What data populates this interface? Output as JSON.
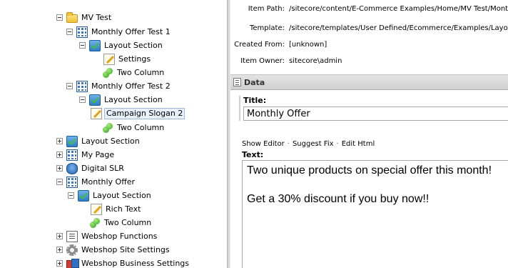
{
  "tree": [
    {
      "label": "MV Test",
      "icon": "folder-icon",
      "expanded": true
    },
    {
      "label": "Monthly Offer Test 1",
      "icon": "template-grid-icon",
      "expanded": true
    },
    {
      "label": "Layout Section",
      "icon": "layout-section-icon",
      "expanded": true
    },
    {
      "label": "Settings",
      "icon": "rendering-icon"
    },
    {
      "label": "Two Column",
      "icon": "sublayout-icon"
    },
    {
      "label": "Monthly Offer Test 2",
      "icon": "template-grid-icon",
      "expanded": true
    },
    {
      "label": "Layout Section",
      "icon": "layout-section-icon",
      "expanded": true
    },
    {
      "label": "Campaign Slogan 2",
      "icon": "rendering-icon",
      "selected": true
    },
    {
      "label": "Two Column",
      "icon": "sublayout-icon"
    },
    {
      "label": "Layout Section",
      "icon": "layout-section-icon",
      "expanded": false
    },
    {
      "label": "My Page",
      "icon": "template-grid-icon",
      "expanded": false
    },
    {
      "label": "Digital SLR",
      "icon": "camera-icon",
      "expanded": false
    },
    {
      "label": "Monthly Offer",
      "icon": "template-grid-icon",
      "expanded": true
    },
    {
      "label": "Layout Section",
      "icon": "layout-section-icon",
      "expanded": true
    },
    {
      "label": "Rich Text",
      "icon": "rendering-icon"
    },
    {
      "label": "Two Column",
      "icon": "sublayout-icon"
    },
    {
      "label": "Webshop Functions",
      "icon": "document-icon",
      "expanded": false
    },
    {
      "label": "Webshop Site Settings",
      "icon": "gear-icon",
      "expanded": false
    },
    {
      "label": "Webshop Business Settings",
      "icon": "business-icon",
      "expanded": false
    }
  ],
  "info": {
    "item_path_label": "Item Path:",
    "item_path": "/sitecore/content/E-Commerce Examples/Home/MV Test/Monthly",
    "template_label": "Template:",
    "template": "/sitecore/templates/User Defined/Ecommerce/Examples/Layout",
    "created_from_label": "Created From:",
    "created_from": "[unknown]",
    "item_owner_label": "Item Owner:",
    "item_owner": "sitecore\\admin"
  },
  "section": {
    "title": "Data"
  },
  "fields": {
    "title_label": "Title:",
    "title_value": "Monthly Offer",
    "show_editor": "Show Editor",
    "suggest_fix": "Suggest Fix",
    "edit_html": "Edit Html",
    "separator": "·",
    "text_label": "Text:",
    "text_line1": "Two unique products on special offer this month!",
    "text_line2": "Get a 30% discount if you buy now!!"
  }
}
